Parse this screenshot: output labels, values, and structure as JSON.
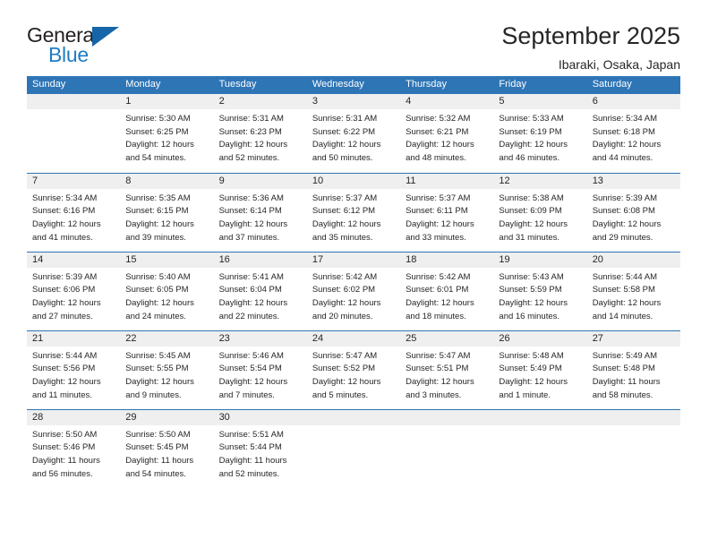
{
  "brand": {
    "name_part1": "General",
    "name_part2": "Blue",
    "logo_icon": "triangle-logo-icon",
    "accent_color": "#1565a8",
    "blue_text_color": "#1f7dc4"
  },
  "header": {
    "title": "September 2025",
    "subtitle": "Ibaraki, Osaka, Japan"
  },
  "theme": {
    "header_row_bg": "#2e75b6",
    "daynum_band_bg": "#efefef",
    "grid_line_color": "#2e75b6",
    "text_color": "#262626"
  },
  "calendar": {
    "weekday_headers": [
      "Sunday",
      "Monday",
      "Tuesday",
      "Wednesday",
      "Thursday",
      "Friday",
      "Saturday"
    ],
    "weeks": [
      [
        {
          "day": "",
          "empty": true,
          "lines": []
        },
        {
          "day": "1",
          "lines": [
            "Sunrise: 5:30 AM",
            "Sunset: 6:25 PM",
            "Daylight: 12 hours",
            "and 54 minutes."
          ]
        },
        {
          "day": "2",
          "lines": [
            "Sunrise: 5:31 AM",
            "Sunset: 6:23 PM",
            "Daylight: 12 hours",
            "and 52 minutes."
          ]
        },
        {
          "day": "3",
          "lines": [
            "Sunrise: 5:31 AM",
            "Sunset: 6:22 PM",
            "Daylight: 12 hours",
            "and 50 minutes."
          ]
        },
        {
          "day": "4",
          "lines": [
            "Sunrise: 5:32 AM",
            "Sunset: 6:21 PM",
            "Daylight: 12 hours",
            "and 48 minutes."
          ]
        },
        {
          "day": "5",
          "lines": [
            "Sunrise: 5:33 AM",
            "Sunset: 6:19 PM",
            "Daylight: 12 hours",
            "and 46 minutes."
          ]
        },
        {
          "day": "6",
          "lines": [
            "Sunrise: 5:34 AM",
            "Sunset: 6:18 PM",
            "Daylight: 12 hours",
            "and 44 minutes."
          ]
        }
      ],
      [
        {
          "day": "7",
          "lines": [
            "Sunrise: 5:34 AM",
            "Sunset: 6:16 PM",
            "Daylight: 12 hours",
            "and 41 minutes."
          ]
        },
        {
          "day": "8",
          "lines": [
            "Sunrise: 5:35 AM",
            "Sunset: 6:15 PM",
            "Daylight: 12 hours",
            "and 39 minutes."
          ]
        },
        {
          "day": "9",
          "lines": [
            "Sunrise: 5:36 AM",
            "Sunset: 6:14 PM",
            "Daylight: 12 hours",
            "and 37 minutes."
          ]
        },
        {
          "day": "10",
          "lines": [
            "Sunrise: 5:37 AM",
            "Sunset: 6:12 PM",
            "Daylight: 12 hours",
            "and 35 minutes."
          ]
        },
        {
          "day": "11",
          "lines": [
            "Sunrise: 5:37 AM",
            "Sunset: 6:11 PM",
            "Daylight: 12 hours",
            "and 33 minutes."
          ]
        },
        {
          "day": "12",
          "lines": [
            "Sunrise: 5:38 AM",
            "Sunset: 6:09 PM",
            "Daylight: 12 hours",
            "and 31 minutes."
          ]
        },
        {
          "day": "13",
          "lines": [
            "Sunrise: 5:39 AM",
            "Sunset: 6:08 PM",
            "Daylight: 12 hours",
            "and 29 minutes."
          ]
        }
      ],
      [
        {
          "day": "14",
          "lines": [
            "Sunrise: 5:39 AM",
            "Sunset: 6:06 PM",
            "Daylight: 12 hours",
            "and 27 minutes."
          ]
        },
        {
          "day": "15",
          "lines": [
            "Sunrise: 5:40 AM",
            "Sunset: 6:05 PM",
            "Daylight: 12 hours",
            "and 24 minutes."
          ]
        },
        {
          "day": "16",
          "lines": [
            "Sunrise: 5:41 AM",
            "Sunset: 6:04 PM",
            "Daylight: 12 hours",
            "and 22 minutes."
          ]
        },
        {
          "day": "17",
          "lines": [
            "Sunrise: 5:42 AM",
            "Sunset: 6:02 PM",
            "Daylight: 12 hours",
            "and 20 minutes."
          ]
        },
        {
          "day": "18",
          "lines": [
            "Sunrise: 5:42 AM",
            "Sunset: 6:01 PM",
            "Daylight: 12 hours",
            "and 18 minutes."
          ]
        },
        {
          "day": "19",
          "lines": [
            "Sunrise: 5:43 AM",
            "Sunset: 5:59 PM",
            "Daylight: 12 hours",
            "and 16 minutes."
          ]
        },
        {
          "day": "20",
          "lines": [
            "Sunrise: 5:44 AM",
            "Sunset: 5:58 PM",
            "Daylight: 12 hours",
            "and 14 minutes."
          ]
        }
      ],
      [
        {
          "day": "21",
          "lines": [
            "Sunrise: 5:44 AM",
            "Sunset: 5:56 PM",
            "Daylight: 12 hours",
            "and 11 minutes."
          ]
        },
        {
          "day": "22",
          "lines": [
            "Sunrise: 5:45 AM",
            "Sunset: 5:55 PM",
            "Daylight: 12 hours",
            "and 9 minutes."
          ]
        },
        {
          "day": "23",
          "lines": [
            "Sunrise: 5:46 AM",
            "Sunset: 5:54 PM",
            "Daylight: 12 hours",
            "and 7 minutes."
          ]
        },
        {
          "day": "24",
          "lines": [
            "Sunrise: 5:47 AM",
            "Sunset: 5:52 PM",
            "Daylight: 12 hours",
            "and 5 minutes."
          ]
        },
        {
          "day": "25",
          "lines": [
            "Sunrise: 5:47 AM",
            "Sunset: 5:51 PM",
            "Daylight: 12 hours",
            "and 3 minutes."
          ]
        },
        {
          "day": "26",
          "lines": [
            "Sunrise: 5:48 AM",
            "Sunset: 5:49 PM",
            "Daylight: 12 hours",
            "and 1 minute."
          ]
        },
        {
          "day": "27",
          "lines": [
            "Sunrise: 5:49 AM",
            "Sunset: 5:48 PM",
            "Daylight: 11 hours",
            "and 58 minutes."
          ]
        }
      ],
      [
        {
          "day": "28",
          "lines": [
            "Sunrise: 5:50 AM",
            "Sunset: 5:46 PM",
            "Daylight: 11 hours",
            "and 56 minutes."
          ]
        },
        {
          "day": "29",
          "lines": [
            "Sunrise: 5:50 AM",
            "Sunset: 5:45 PM",
            "Daylight: 11 hours",
            "and 54 minutes."
          ]
        },
        {
          "day": "30",
          "lines": [
            "Sunrise: 5:51 AM",
            "Sunset: 5:44 PM",
            "Daylight: 11 hours",
            "and 52 minutes."
          ]
        },
        {
          "day": "",
          "empty": true,
          "lines": []
        },
        {
          "day": "",
          "empty": true,
          "lines": []
        },
        {
          "day": "",
          "empty": true,
          "lines": []
        },
        {
          "day": "",
          "empty": true,
          "lines": []
        }
      ]
    ]
  }
}
